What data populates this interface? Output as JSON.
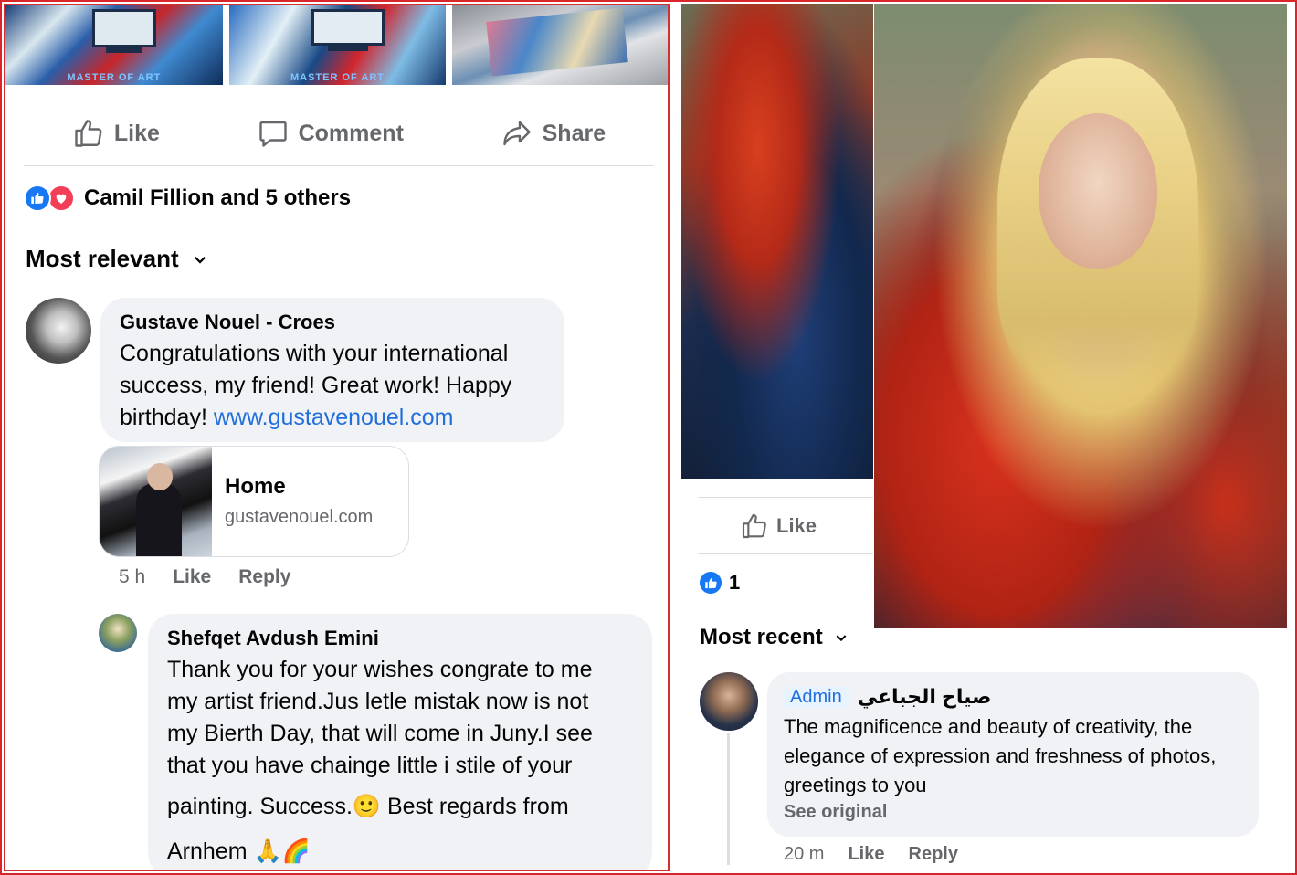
{
  "left": {
    "thumbnails": [
      {
        "caption": "MASTER OF ART"
      },
      {
        "caption": "MASTER OF ART"
      },
      {
        "caption": ""
      }
    ],
    "actions": {
      "like": "Like",
      "comment": "Comment",
      "share": "Share"
    },
    "reactions_text": "Camil Fillion and 5 others",
    "sort_label": "Most relevant",
    "comment1": {
      "author": "Gustave Nouel - Croes",
      "text": "Congratulations with your international success, my friend! Great work! Happy birthday! ",
      "link_text": "www.gustavenouel.com",
      "link_card": {
        "title": "Home",
        "domain": "gustavenouel.com"
      },
      "time": "5 h",
      "like": "Like",
      "reply": "Reply"
    },
    "comment2": {
      "author": "Shefqet Avdush Emini",
      "text_lines": [
        "Thank you for your wishes congrate to me",
        "my artist friend.Jus letle mistak now is not",
        "my Bierth Day, that will come in Juny.I  see",
        "that you have chainge little i stile of your",
        "painting. Success.🙂 Best regards from",
        "Arnhem 🙏🌈"
      ]
    }
  },
  "right": {
    "like_label": "Like",
    "reaction_count": "1",
    "sort_label": "Most recent",
    "comment": {
      "badge": "Admin",
      "author": "صياح الجباعي",
      "text": "The magnificence and beauty of creativity, the elegance of expression and freshness of photos, greetings to you",
      "see_original": "See original",
      "time": "20 m",
      "like": "Like",
      "reply": "Reply"
    }
  },
  "colors": {
    "accent": "#1877f2",
    "love": "#f33e58",
    "frame": "#d9262b",
    "link": "#216fdb"
  }
}
